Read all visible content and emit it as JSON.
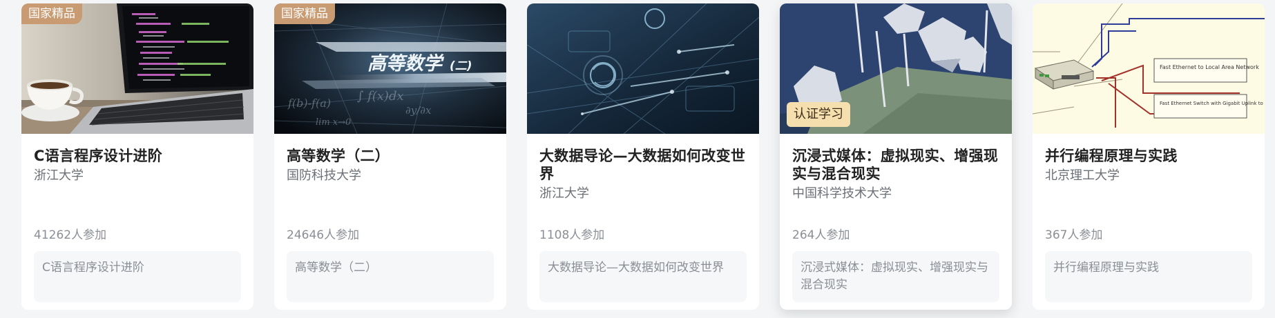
{
  "cards": [
    {
      "badge": "国家精品",
      "title": "C语言程序设计进阶",
      "school": "浙江大学",
      "participants": "41262人参加",
      "description": "C语言程序设计进阶",
      "cover_icon": "laptop-coffee-image"
    },
    {
      "badge": "国家精品",
      "title": "高等数学（二）",
      "school": "国防科技大学",
      "participants": "24646人参加",
      "description": "高等数学（二）",
      "cover_text": "高等数学",
      "cover_text_small": "(二)",
      "cover_icon": "math-formula-image"
    },
    {
      "title": "大数据导论—大数据如何改变世界",
      "school": "浙江大学",
      "participants": "1108人参加",
      "description": "大数据导论—大数据如何改变世界",
      "cover_icon": "hud-circuit-image"
    },
    {
      "badge_cert": "认证学习",
      "title": "沉浸式媒体：虚拟现实、增强现实与混合现实",
      "school": "中国科学技术大学",
      "participants": "264人参加",
      "description": "沉浸式媒体：虚拟现实、增强现实与混合现实",
      "cover_icon": "lowpoly-island-image"
    },
    {
      "title": "并行编程原理与实践",
      "school": "北京理工大学",
      "participants": "367人参加",
      "description": "并行编程原理与实践",
      "cover_text": "Fast Ethernet to Local Area Network",
      "cover_text_2": "Fast Ethernet Switch with Gigabit Uplink to Frontend",
      "cover_icon": "network-diagram-image"
    }
  ],
  "colors": {
    "badge_bg": "#c89b72",
    "cert_bg": "#f6dfae",
    "page_bg": "#f4f5f7"
  }
}
